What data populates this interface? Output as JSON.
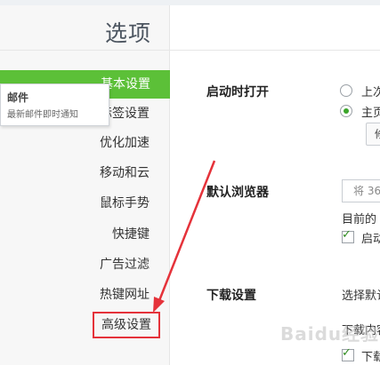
{
  "header": {
    "title": "选项"
  },
  "sidebar": {
    "items": [
      {
        "label": "基本设置",
        "state": "active"
      },
      {
        "label": "标签设置"
      },
      {
        "label": "优化加速"
      },
      {
        "label": "移动和云"
      },
      {
        "label": "鼠标手势"
      },
      {
        "label": "快捷键"
      },
      {
        "label": "广告过滤"
      },
      {
        "label": "热键网址"
      },
      {
        "label": "高级设置",
        "state": "highlighted"
      }
    ]
  },
  "tooltip": {
    "title": "邮件",
    "description": "最新邮件即时通知"
  },
  "main": {
    "startup": {
      "label": "启动时打开",
      "options": [
        {
          "text": "上次",
          "selected": false
        },
        {
          "text": "主页",
          "selected": true
        }
      ],
      "button_label": "修"
    },
    "default_browser": {
      "label": "默认浏览器",
      "button_text": "将 36",
      "current_text": "目前的",
      "checkbox_text": "启动"
    },
    "download": {
      "label": "下载设置",
      "choose_text": "选择默认",
      "content_text": "下载内容",
      "checkbox_text": "下载"
    }
  },
  "watermark": "Baidu经验",
  "colors": {
    "active_nav": "#5cc038",
    "highlight_box": "#e5323a",
    "check_green": "#3ba52a"
  }
}
